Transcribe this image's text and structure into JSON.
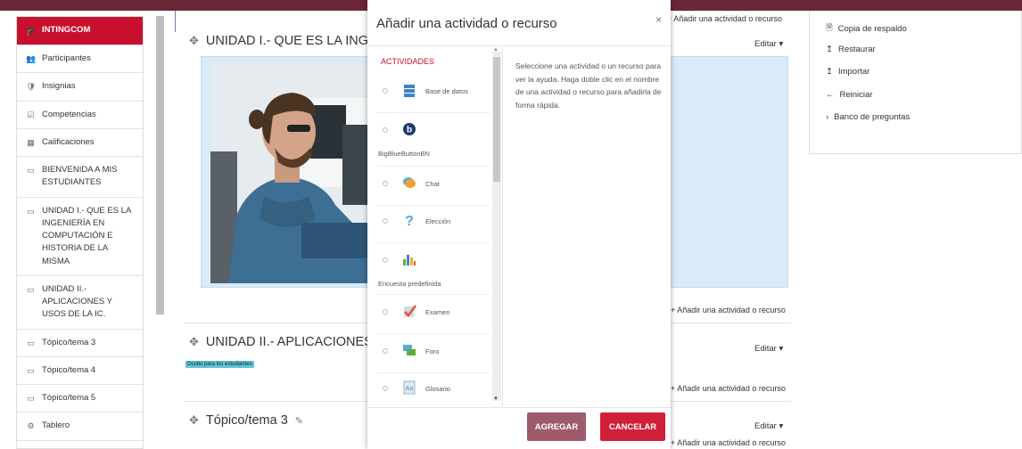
{
  "nav": {
    "items": [
      {
        "icon": "graduation-cap-icon",
        "glyph": "🎓",
        "label": "INTINGCOM",
        "active": true
      },
      {
        "icon": "users-icon",
        "glyph": "👥",
        "label": "Participantes"
      },
      {
        "icon": "badge-icon",
        "glyph": "🛡",
        "label": "Insignias"
      },
      {
        "icon": "checkbox-icon",
        "glyph": "☑",
        "label": "Competencias"
      },
      {
        "icon": "table-icon",
        "glyph": "▦",
        "label": "Calificaciones"
      },
      {
        "icon": "folder-icon",
        "glyph": "▭",
        "label": "BIENVENIDA A MIS ESTUDIANTES"
      },
      {
        "icon": "folder-icon",
        "glyph": "▭",
        "label": "UNIDAD I.- QUE ES LA INGENIERÍA EN COMPUTACIÓN E HISTORIA DE LA MISMA"
      },
      {
        "icon": "folder-icon",
        "glyph": "▭",
        "label": "UNIDAD II.- APLICACIONES Y USOS DE LA IC."
      },
      {
        "icon": "folder-icon",
        "glyph": "▭",
        "label": "Tópico/tema 3"
      },
      {
        "icon": "folder-icon",
        "glyph": "▭",
        "label": "Tópico/tema 4"
      },
      {
        "icon": "folder-icon",
        "glyph": "▭",
        "label": "Tópico/tema 5"
      },
      {
        "icon": "dashboard-icon",
        "glyph": "⚙",
        "label": "Tablero"
      }
    ]
  },
  "main": {
    "section1_title": "UNIDAD I.- QUE ES LA INGENI",
    "section2_title": "UNIDAD II.- APLICACIONES Y",
    "section3_title": "Tópico/tema 3",
    "hidden_badge": "Oculto para los estudiantes",
    "editar": "Editar",
    "add_activity": "Añadir una actividad o recurso"
  },
  "right": {
    "items": [
      {
        "icon": "file-icon",
        "glyph": "🗎",
        "label": "Copia de respaldo"
      },
      {
        "icon": "upload-icon",
        "glyph": "↥",
        "label": "Restaurar"
      },
      {
        "icon": "upload-icon",
        "glyph": "↥",
        "label": "Importar"
      },
      {
        "icon": "arrow-left-icon",
        "glyph": "←",
        "label": "Reiniciar"
      },
      {
        "icon": "chevron-right-icon",
        "glyph": "›",
        "label": "Banco de preguntas"
      }
    ]
  },
  "modal": {
    "title": "Añadir una actividad o recurso",
    "close": "×",
    "category": "ACTIVIDADES",
    "help": "Seleccione una actividad o un recurso para ver la ayuda. Haga doble clic en el nombre de una actividad o recurso para añadirla de forma rápida.",
    "add_button": "AGREGAR",
    "cancel_button": "CANCELAR",
    "activities": [
      {
        "label": "Base de datos",
        "icon": "database-icon",
        "color": "#3e84c6"
      },
      {
        "label": "BigBlueButtonBN",
        "icon": "bigbluebutton-icon",
        "color": "#1c3a6b"
      },
      {
        "label": "Chat",
        "icon": "chat-icon",
        "color": "#f0a030"
      },
      {
        "label": "Elección",
        "icon": "question-icon",
        "color": "#5aa6e0"
      },
      {
        "label": "Encuesta predefinida",
        "icon": "bar-chart-icon",
        "color": "#f2b01e"
      },
      {
        "label": "Examen",
        "icon": "quiz-icon",
        "color": "#e05a2a"
      },
      {
        "label": "Foro",
        "icon": "forum-icon",
        "color": "#5cae3c"
      },
      {
        "label": "Glosario",
        "icon": "glossary-icon",
        "color": "#4a8fd0"
      }
    ]
  }
}
